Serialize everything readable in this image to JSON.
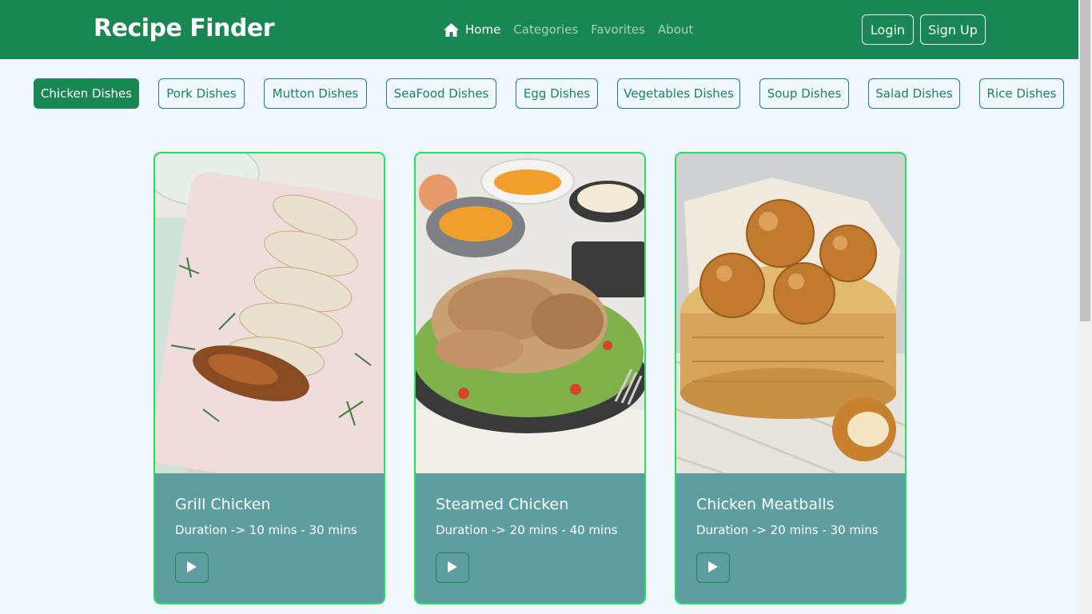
{
  "brand": "Recipe Finder",
  "nav": {
    "home": "Home",
    "categories": "Categories",
    "favorites": "Favorites",
    "about": "About"
  },
  "auth": {
    "login": "Login",
    "signup": "Sign Up"
  },
  "categories": [
    "Chicken Dishes",
    "Pork Dishes",
    "Mutton Dishes",
    "SeaFood Dishes",
    "Egg Dishes",
    "Vegetables Dishes",
    "Soup Dishes",
    "Salad Dishes",
    "Rice Dishes"
  ],
  "active_category": "Chicken Dishes",
  "recipes": [
    {
      "title": "Grill Chicken",
      "duration": "Duration -> 10 mins - 30 mins",
      "image": "grilled-chicken-photo",
      "action": "play-icon"
    },
    {
      "title": "Steamed Chicken",
      "duration": "Duration -> 20 mins - 40 mins",
      "image": "roast-chicken-photo",
      "action": "play-icon"
    },
    {
      "title": "Chicken Meatballs",
      "duration": "Duration -> 20 mins - 30 mins",
      "image": "fried-meatballs-photo",
      "action": "play-icon"
    }
  ],
  "colors": {
    "primary": "#198754",
    "background": "#f0f7ff",
    "card_body": "#5f9ea0",
    "card_border": "#22e05a"
  }
}
